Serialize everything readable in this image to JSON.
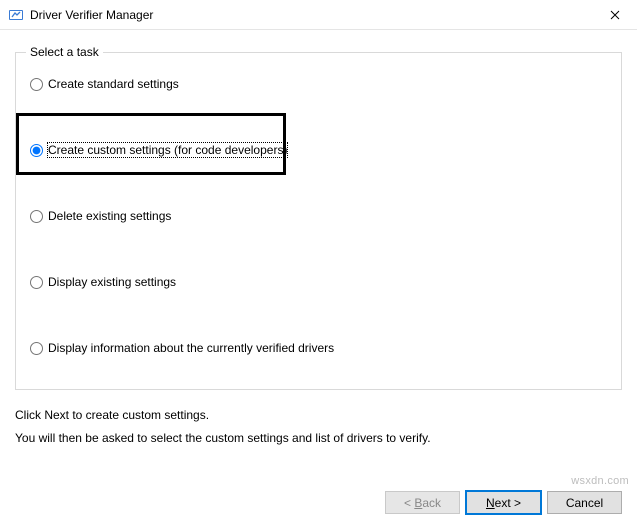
{
  "window": {
    "title": "Driver Verifier Manager"
  },
  "group": {
    "legend": "Select a task"
  },
  "tasks": {
    "create_standard": {
      "label": "Create standard settings",
      "checked": false
    },
    "create_custom": {
      "label": "Create custom settings (for code developers)",
      "checked": true
    },
    "delete_existing": {
      "label": "Delete existing settings",
      "checked": false
    },
    "display_existing": {
      "label": "Display existing settings",
      "checked": false
    },
    "display_info": {
      "label": "Display information about the currently verified drivers",
      "checked": false
    }
  },
  "instructions": {
    "line1": "Click Next to create custom settings.",
    "line2": "You will then be asked to select the custom settings and list of drivers to verify."
  },
  "buttons": {
    "back_prefix": "< ",
    "back_mnemonic": "B",
    "back_suffix": "ack",
    "next_mnemonic": "N",
    "next_suffix": "ext >",
    "cancel": "Cancel"
  },
  "watermark": "wsxdn.com"
}
